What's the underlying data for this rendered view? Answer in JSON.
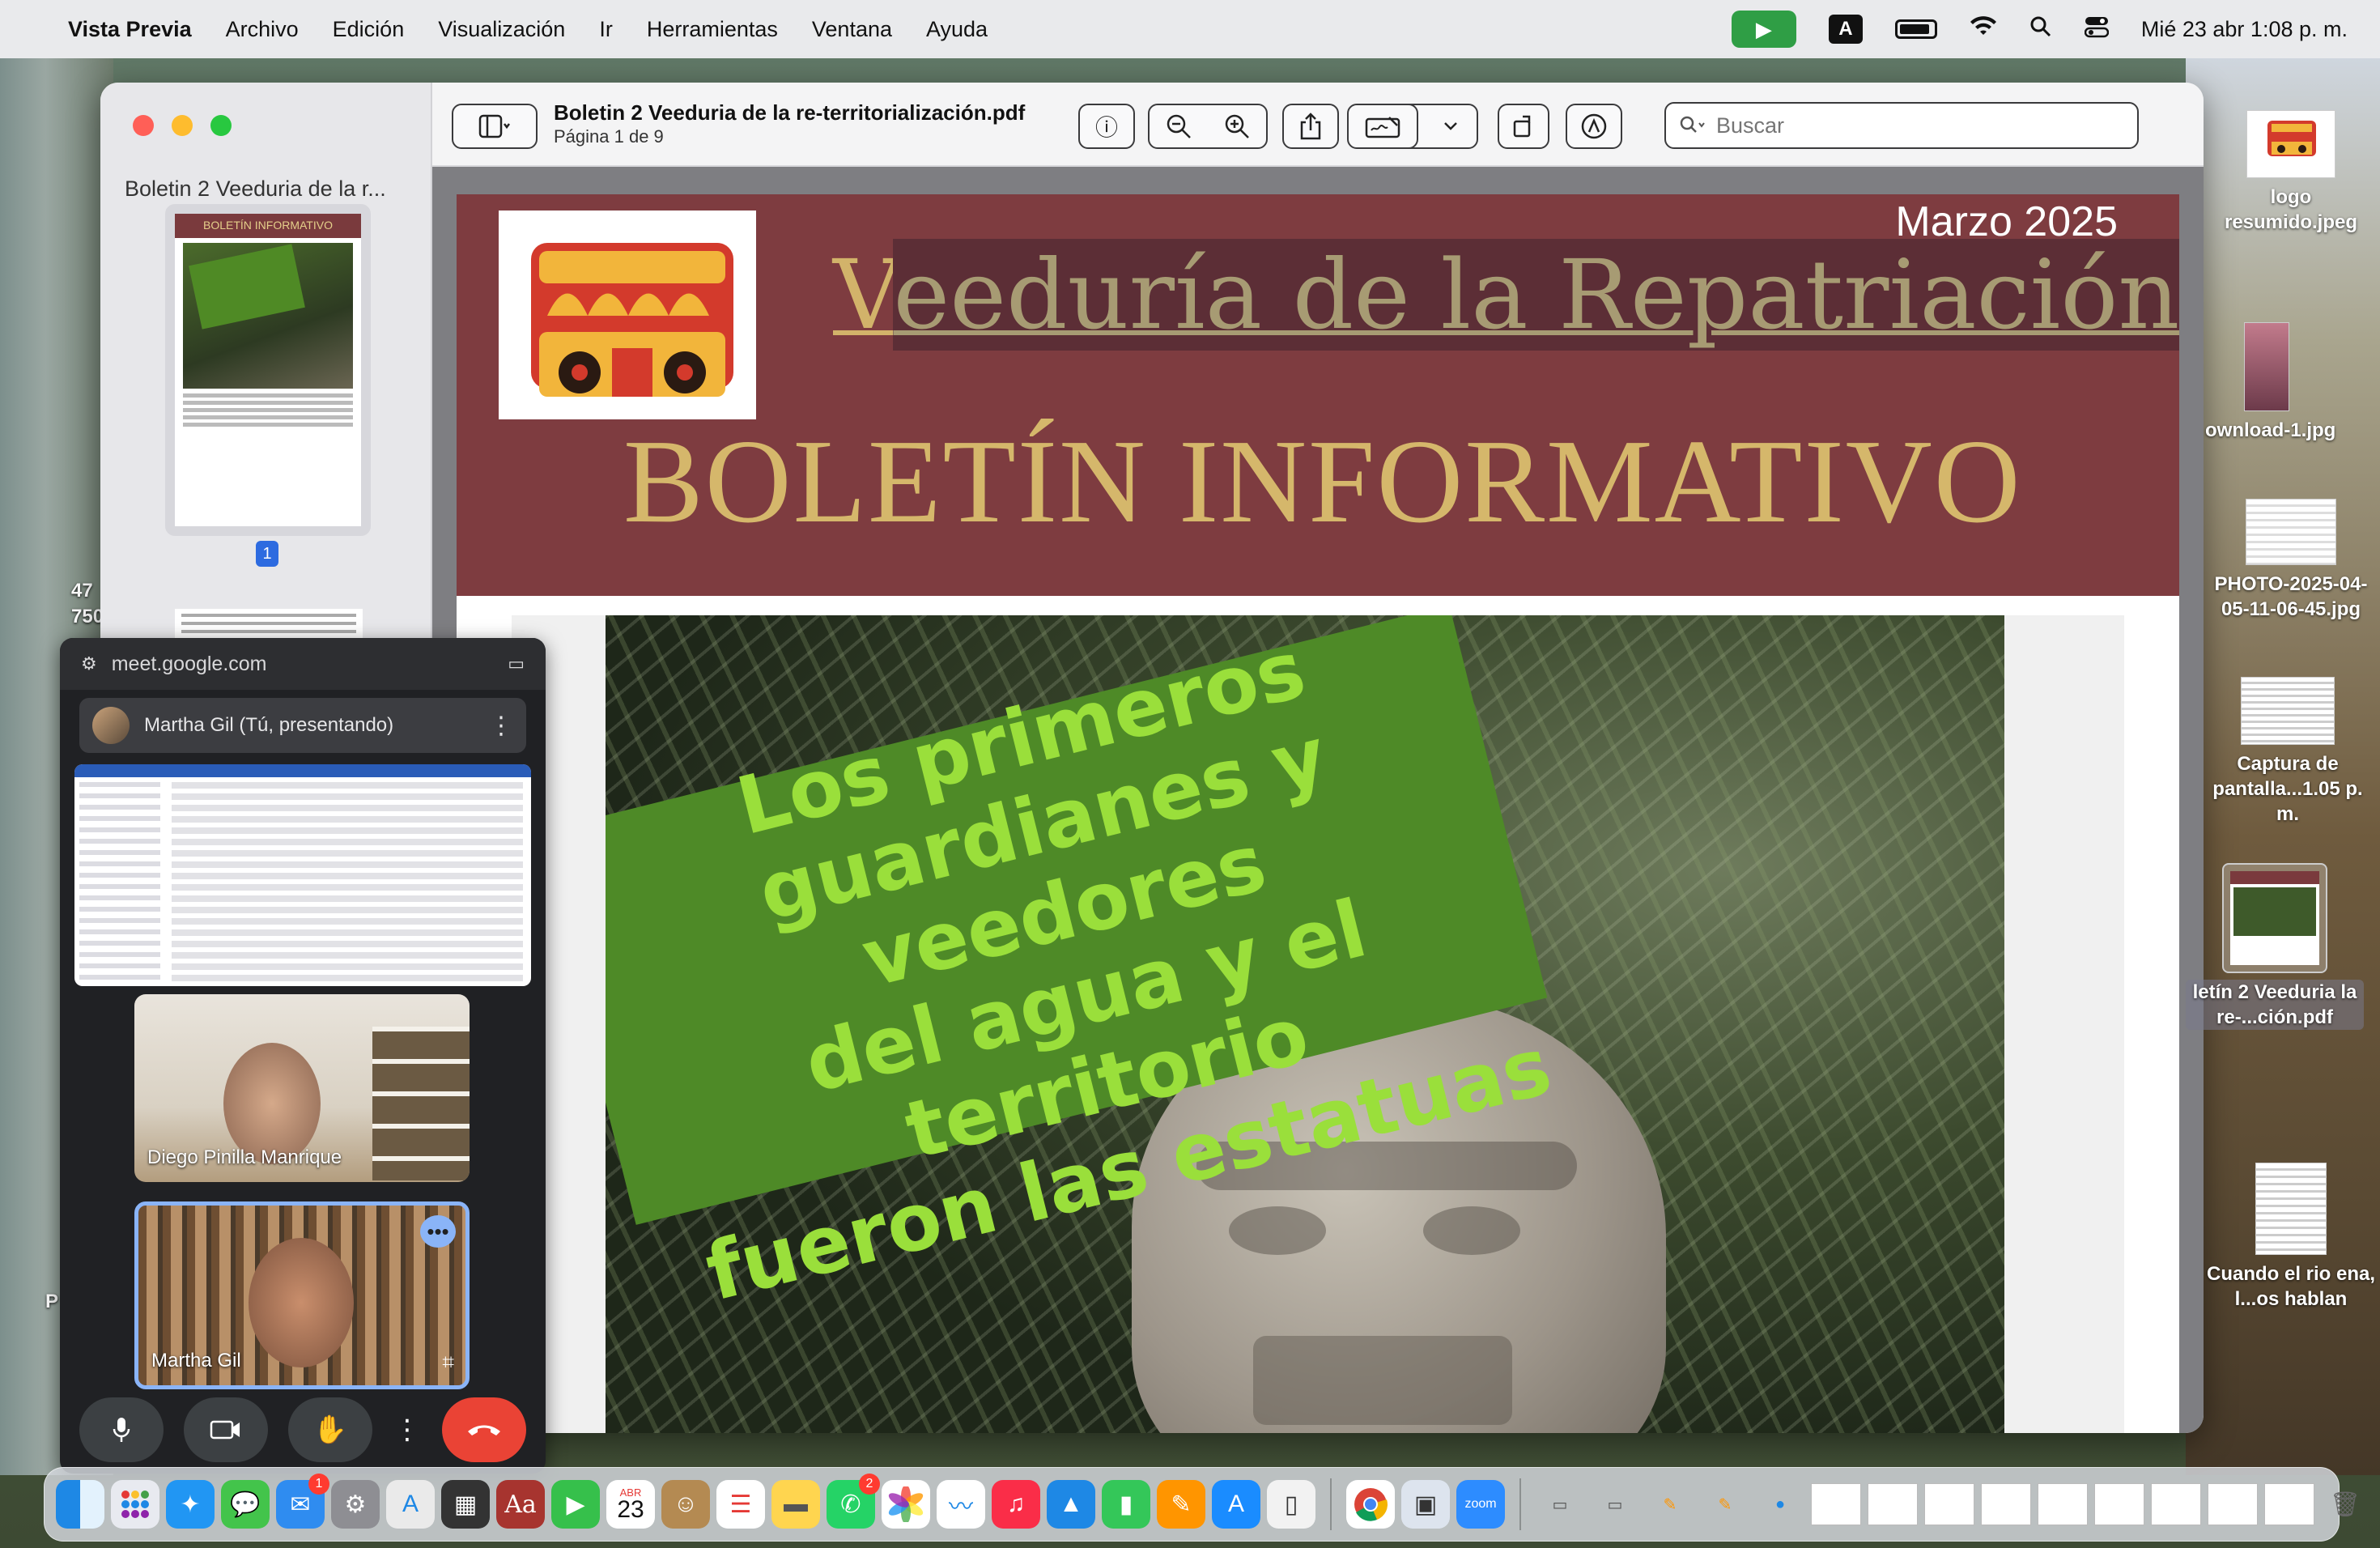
{
  "menubar": {
    "app_name": "Vista Previa",
    "items": [
      "Archivo",
      "Edición",
      "Visualización",
      "Ir",
      "Herramientas",
      "Ventana",
      "Ayuda"
    ],
    "clock": "Mié 23 abr 1:08 p. m.",
    "input_source": "A"
  },
  "preview": {
    "sidebar_title": "Boletin 2 Veeduria de la r...",
    "current_page_badge": "1",
    "doc_title": "Boletin 2 Veeduria de la re-territorialización.pdf",
    "doc_subtitle": "Página 1 de 9",
    "search_placeholder": "Buscar"
  },
  "document": {
    "month": "Marzo 2025",
    "heading_first_letter": "V",
    "heading_rest": "eeduría de la Repatriación",
    "subheading": "BOLETÍN INFORMATIVO",
    "panel_lines": [
      "Los primeros",
      "guardianes y veedores",
      "del agua y el territorio",
      "fueron las  estatuas"
    ]
  },
  "meet": {
    "url": "meet.google.com",
    "presenter": "Martha Gil (Tú, presentando)",
    "participants": [
      "Diego Pinilla Manrique",
      "Martha Gil"
    ]
  },
  "desktop": {
    "icons": [
      {
        "label": "logo resumido.jpeg"
      },
      {
        "label": "ownload-1.jpg"
      },
      {
        "label": "PHOTO-2025-04-05-11-06-45.jpg"
      },
      {
        "label": "Captura de pantalla...1.05 p. m."
      },
      {
        "label": "letín 2 Veeduria la re-...ción.pdf"
      },
      {
        "label": "Cuando el rio ena, l...os hablan"
      }
    ],
    "partial_left_text_1": "47",
    "partial_left_text_2": "750",
    "partial_left_text_3": "P"
  },
  "dock": {
    "calendar_month": "ABR",
    "calendar_day": "23",
    "mail_badge": "1",
    "whatsapp_badge": "2",
    "zoom_label": "zoom",
    "dictionary_label": "Aa"
  },
  "colors": {
    "banner": "#7e3c40",
    "heading_gold": "#d5b76b",
    "panel_green": "#4e8a27",
    "panel_text": "#9adf3b",
    "meet_end_call": "#ea4335"
  }
}
